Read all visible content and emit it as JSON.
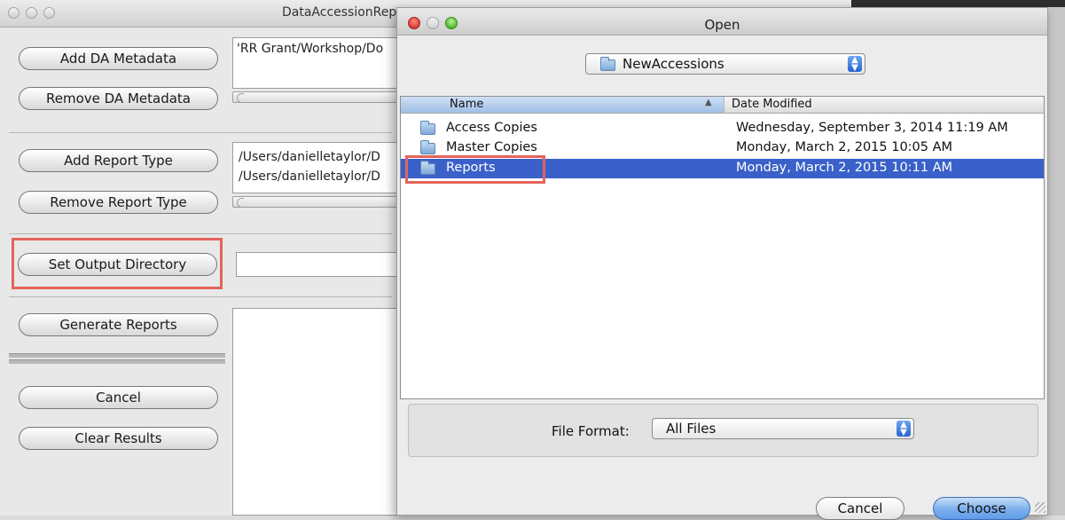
{
  "main_window": {
    "title": "DataAccessionReporter",
    "buttons": {
      "add_da_metadata": "Add DA Metadata",
      "remove_da_metadata": "Remove DA Metadata",
      "add_report_type": "Add Report Type",
      "remove_report_type": "Remove Report Type",
      "set_output_directory": "Set Output Directory",
      "generate_reports": "Generate Reports",
      "cancel": "Cancel",
      "clear_results": "Clear Results"
    },
    "da_metadata_paths": [
      "'RR Grant/Workshop/Do"
    ],
    "report_type_paths": [
      "/Users/danielletaylor/D",
      "/Users/danielletaylor/D"
    ],
    "output_directory_value": ""
  },
  "open_dialog": {
    "title": "Open",
    "location_popup": "NewAccessions",
    "columns": {
      "name": "Name",
      "date_modified": "Date Modified"
    },
    "files": [
      {
        "name": "Access Copies",
        "date_modified": "Wednesday, September 3, 2014 11:19 AM",
        "selected": false
      },
      {
        "name": "Master Copies",
        "date_modified": "Monday, March 2, 2015 10:05 AM",
        "selected": false
      },
      {
        "name": "Reports",
        "date_modified": "Monday, March 2, 2015 10:11 AM",
        "selected": true
      }
    ],
    "file_format_label": "File Format:",
    "file_format_value": "All Files",
    "cancel_label": "Cancel",
    "choose_label": "Choose"
  },
  "colors": {
    "highlight": "#e3645a",
    "selection": "#3a61c9",
    "close_light": "#e0443e"
  },
  "icons": [
    "folder-icon",
    "popup-arrows-icon",
    "sort-ascending-icon",
    "resize-grip-icon"
  ]
}
